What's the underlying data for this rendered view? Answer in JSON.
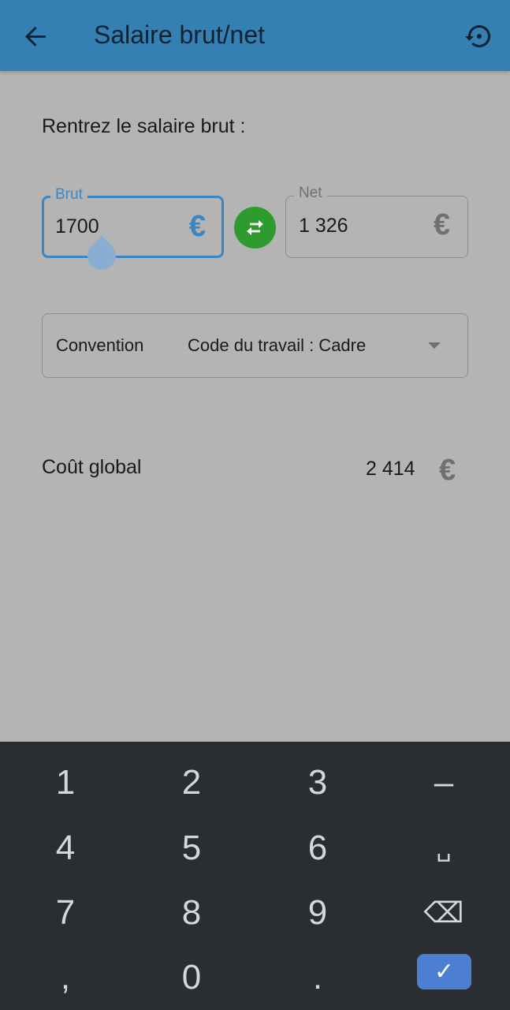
{
  "appbar": {
    "title": "Salaire brut/net",
    "back_icon": "arrow-left-icon",
    "history_icon": "history-icon"
  },
  "form": {
    "intro": "Rentrez le salaire brut :",
    "brut": {
      "label": "Brut",
      "value": "1700",
      "unit": "€"
    },
    "net": {
      "label": "Net",
      "value": "1 326",
      "unit": "€"
    },
    "swap_icon": "swap-horizontal-icon",
    "convention": {
      "label": "Convention",
      "value": "Code du travail : Cadre"
    },
    "total": {
      "label": "Coût global",
      "value": "2 414",
      "unit": "€"
    }
  },
  "keyboard": {
    "keys": [
      "1",
      "2",
      "3",
      "–",
      "4",
      "5",
      "6",
      "␣",
      "7",
      "8",
      "9",
      "⌫",
      ",",
      "0",
      ".",
      "✓"
    ]
  },
  "colors": {
    "appbar": "#3580b3",
    "accent": "#3c86c2",
    "swap": "#2e9b2e",
    "keyboard_bg": "#2a2d31",
    "ok_key": "#4c7fd1"
  }
}
